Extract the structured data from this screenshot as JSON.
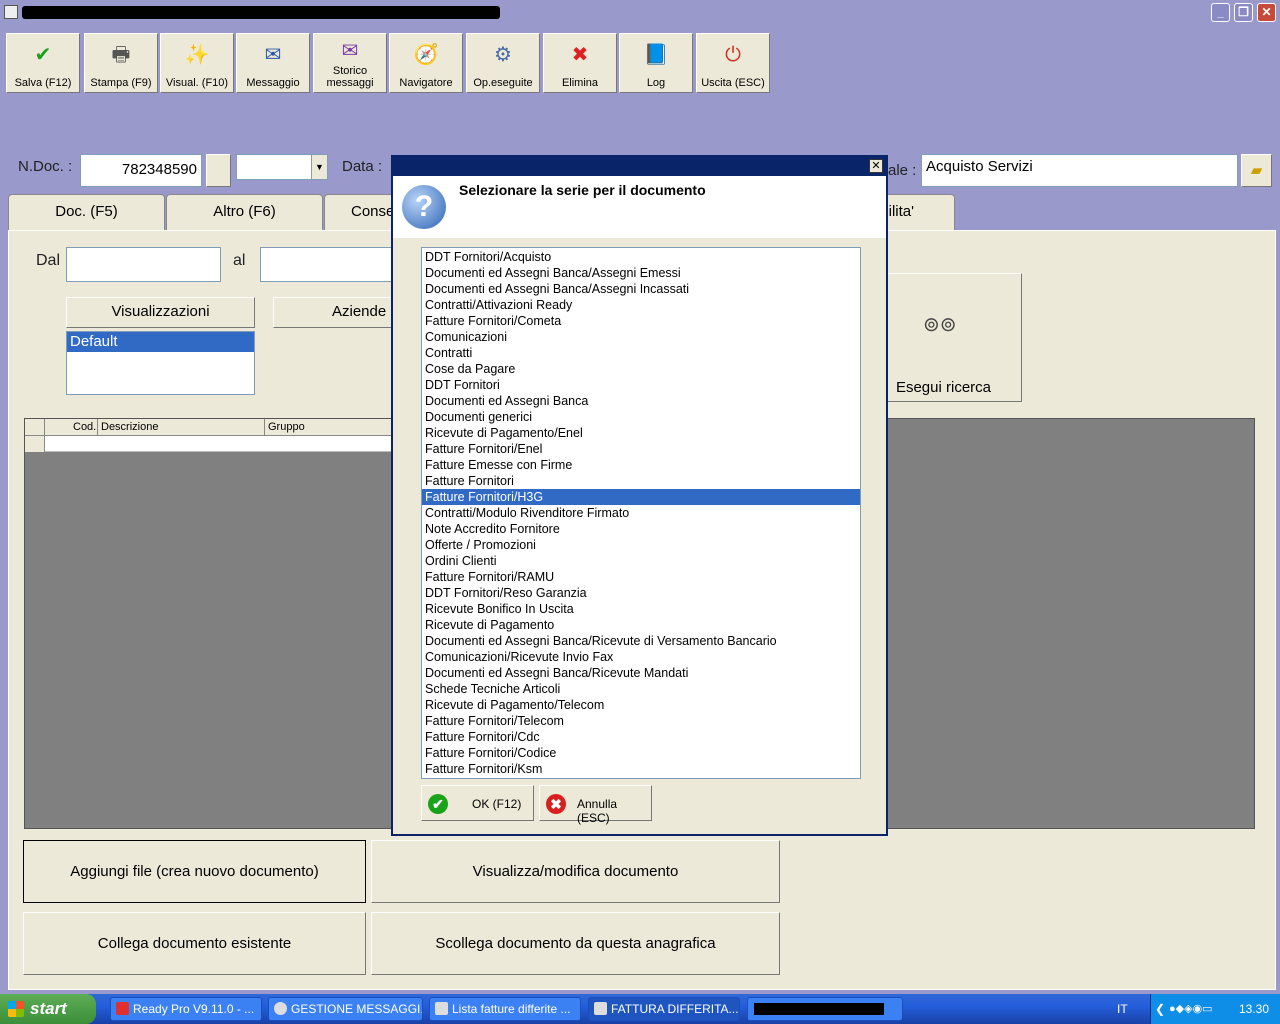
{
  "window": {
    "close_glyph": "✕",
    "restore_glyph": "❐",
    "minimize_glyph": "_"
  },
  "toolbar": [
    {
      "name": "save-button",
      "label": "Salva (F12)",
      "icon": "check-icon",
      "glyph": "✔",
      "color": "#1aa31a"
    },
    {
      "name": "print-button",
      "label": "Stampa (F9)",
      "icon": "printer-icon",
      "glyph": "🖶",
      "color": "#555555"
    },
    {
      "name": "view-button",
      "label": "Visual. (F10)",
      "icon": "magic-wand-icon",
      "glyph": "✨",
      "color": "#d4a400"
    },
    {
      "name": "message-button",
      "label": "Messaggio",
      "icon": "pen-message-icon",
      "glyph": "✉",
      "color": "#2a5aa8"
    },
    {
      "name": "message-history-button",
      "label": "Storico\nmessaggi",
      "icon": "envelope-search-icon",
      "glyph": "✉",
      "color": "#7a3aa8"
    },
    {
      "name": "navigator-button",
      "label": "Navigatore",
      "icon": "compass-icon",
      "glyph": "🧭",
      "color": "#aa3333"
    },
    {
      "name": "operations-done-button",
      "label": "Op.eseguite",
      "icon": "gears-icon",
      "glyph": "⚙",
      "color": "#4a6aa8"
    },
    {
      "name": "delete-button",
      "label": "Elimina",
      "icon": "red-x-icon",
      "glyph": "✖",
      "color": "#e02020"
    },
    {
      "name": "log-button",
      "label": "Log",
      "icon": "log-book-icon",
      "glyph": "📘",
      "color": "#2a6ad0"
    },
    {
      "name": "exit-button",
      "label": "Uscita (ESC)",
      "icon": "power-icon",
      "glyph": "⏻",
      "color": "#d03020"
    }
  ],
  "header": {
    "ndoc_label": "N.Doc. :",
    "ndoc_value": "782348590",
    "data_label": "Data :",
    "causale_label": "ale :",
    "causale_value": "Acquisto Servizi"
  },
  "tabs": [
    "Doc. (F5)",
    "Altro (F6)",
    "Conse",
    "ilita'"
  ],
  "filters": {
    "dal_label": "Dal",
    "al_label": "al",
    "views_header": "Visualizzazioni",
    "views_selected": "Default",
    "companies_header": "Aziende",
    "search_label": "Esegui ricerca"
  },
  "grid": {
    "columns": [
      "Cod.",
      "Descrizione",
      "Gruppo"
    ]
  },
  "actions": {
    "add_file": "Aggiungi file (crea nuovo documento)",
    "view_edit": "Visualizza/modifica documento",
    "link_existing": "Collega documento esistente",
    "unlink": "Scollega documento da questa anagrafica"
  },
  "dialog": {
    "close_glyph": "✕",
    "question_glyph": "?",
    "message": "Selezionare la serie per il documento",
    "selected_index": 15,
    "items": [
      "DDT Fornitori/Acquisto",
      "Documenti ed Assegni Banca/Assegni Emessi",
      "Documenti ed Assegni Banca/Assegni Incassati",
      "Contratti/Attivazioni Ready",
      "Fatture Fornitori/Cometa",
      "Comunicazioni",
      "Contratti",
      "Cose da Pagare",
      "DDT Fornitori",
      "Documenti ed Assegni Banca",
      "Documenti generici",
      "Ricevute di Pagamento/Enel",
      "Fatture Fornitori/Enel",
      "Fatture Emesse con Firme",
      "Fatture Fornitori",
      "Fatture Fornitori/H3G",
      "Contratti/Modulo Rivenditore Firmato",
      "Note Accredito Fornitore",
      "Offerte / Promozioni",
      "Ordini Clienti",
      "Fatture Fornitori/RAMU",
      "DDT Fornitori/Reso Garanzia",
      "Ricevute Bonifico In Uscita",
      "Ricevute di Pagamento",
      "Documenti ed Assegni Banca/Ricevute di Versamento Bancario",
      "Comunicazioni/Ricevute Invio Fax",
      "Documenti ed Assegni Banca/Ricevute Mandati",
      "Schede Tecniche Articoli",
      "Ricevute di Pagamento/Telecom",
      "Fatture Fornitori/Telecom",
      "Fatture Fornitori/Cdc",
      "Fatture Fornitori/Codice",
      "Fatture Fornitori/Ksm"
    ],
    "ok_label": "OK (F12)",
    "cancel_label": "Annulla (ESC)"
  },
  "taskbar": {
    "start_label": "start",
    "tasks": [
      "Ready Pro V9.11.0 - ...",
      "GESTIONE MESSAGGI...",
      "Lista fatture differite ...",
      "FATTURA DIFFERITA..."
    ],
    "language": "IT",
    "clock": "13.30"
  }
}
